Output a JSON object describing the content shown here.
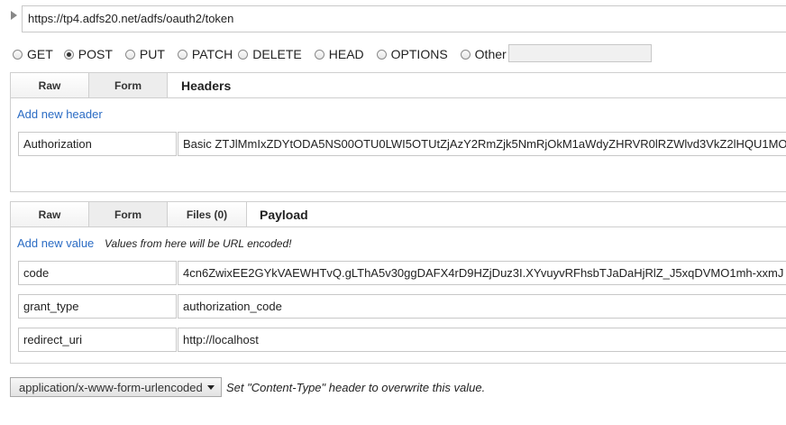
{
  "url": {
    "value": "https://tp4.adfs20.net/adfs/oauth2/token"
  },
  "methods": [
    {
      "label": "GET",
      "checked": false
    },
    {
      "label": "POST",
      "checked": true
    },
    {
      "label": "PUT",
      "checked": false
    },
    {
      "label": "PATCH",
      "checked": false
    },
    {
      "label": "DELETE",
      "checked": false
    },
    {
      "label": "HEAD",
      "checked": false
    },
    {
      "label": "OPTIONS",
      "checked": false
    },
    {
      "label": "Other",
      "checked": false
    }
  ],
  "headers_section": {
    "tabs": [
      "Raw",
      "Form"
    ],
    "title": "Headers",
    "add_link": "Add new header",
    "rows": [
      {
        "key": "Authorization",
        "value": "Basic ZTJlMmIxZDYtODA5NS00OTU0LWI5OTUtZjAzY2RmZjk5NmRjOkM1aWdyZHRVR0lRZWlvd3VkZ2lHQU1MO"
      }
    ]
  },
  "payload_section": {
    "tabs": [
      "Raw",
      "Form",
      "Files (0)"
    ],
    "title": "Payload",
    "add_link": "Add new value",
    "note": "Values from here will be URL encoded!",
    "rows": [
      {
        "key": "code",
        "value": "4cn6ZwixEE2GYkVAEWHTvQ.gLThA5v30ggDAFX4rD9HZjDuz3I.XYvuyvRFhsbTJaDaHjRlZ_J5xqDVMO1mh-xxmJ"
      },
      {
        "key": "grant_type",
        "value": "authorization_code"
      },
      {
        "key": "redirect_uri",
        "value": "http://localhost"
      }
    ]
  },
  "content_type": {
    "selected": "application/x-www-form-urlencoded",
    "note": "Set \"Content-Type\" header to overwrite this value."
  }
}
